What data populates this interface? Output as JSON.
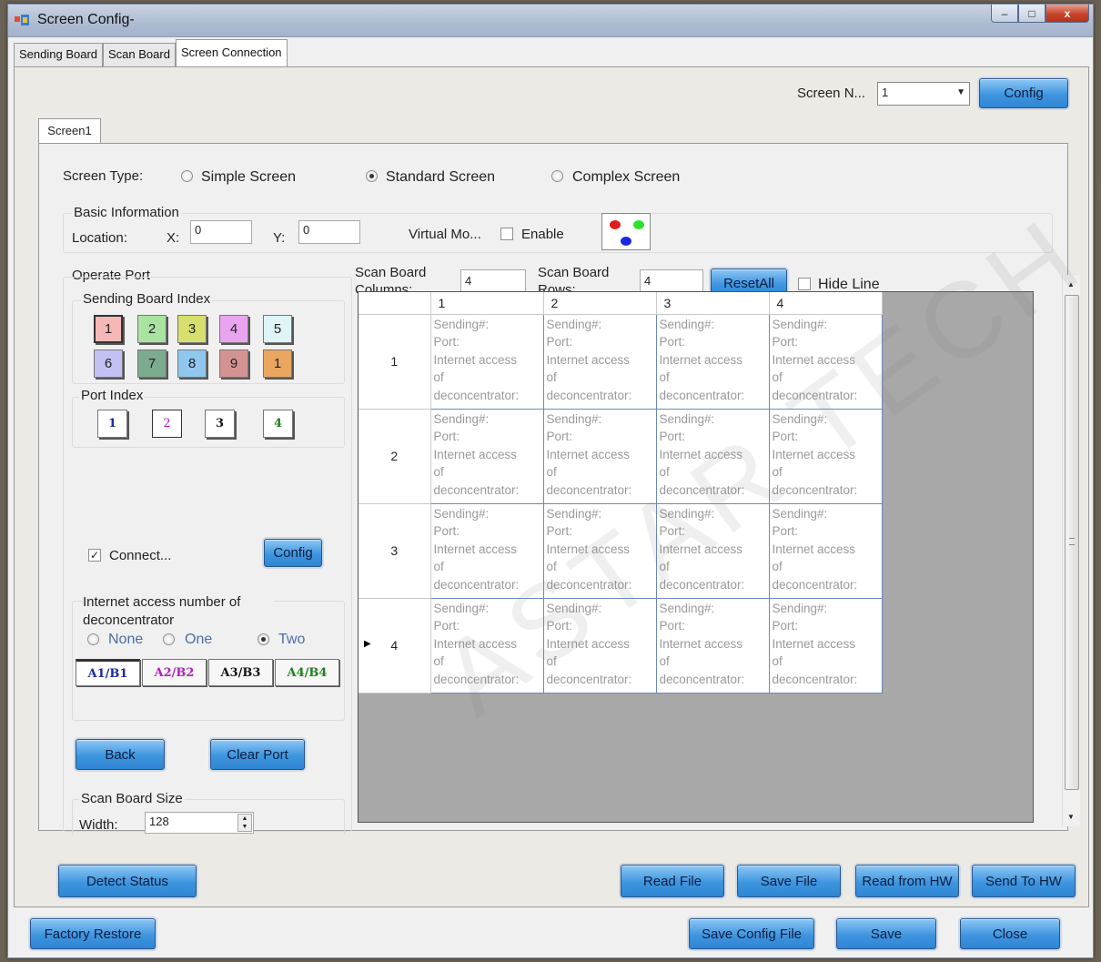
{
  "window": {
    "title": "Screen Config-",
    "controls": [
      "–",
      "□",
      "x"
    ]
  },
  "tabs": [
    "Sending Board",
    "Scan Board",
    "Screen Connection"
  ],
  "active_tab": "Screen Connection",
  "screen_selector": {
    "label": "Screen N...",
    "value": "1",
    "config_label": "Config"
  },
  "screen_tab": "Screen1",
  "screen_type": {
    "label": "Screen Type:",
    "options": [
      "Simple Screen",
      "Standard Screen",
      "Complex Screen"
    ],
    "selected": "Standard Screen"
  },
  "basic_info": {
    "title": "Basic Information",
    "location_label": "Location:",
    "x_label": "X:",
    "x_value": "0",
    "y_label": "Y:",
    "y_value": "0",
    "virtual_label": "Virtual Mo...",
    "enable_label": "Enable",
    "enable_checked": false
  },
  "operate_port": {
    "title": "Operate Port",
    "sending_board_index": {
      "title": "Sending Board Index",
      "buttons": [
        {
          "label": "1",
          "color": "#f6b7b7"
        },
        {
          "label": "2",
          "color": "#a9e3a2"
        },
        {
          "label": "3",
          "color": "#d8e06d"
        },
        {
          "label": "4",
          "color": "#e9a4ef"
        },
        {
          "label": "5",
          "color": "#dff4f6"
        },
        {
          "label": "6",
          "color": "#c3c0f4"
        },
        {
          "label": "7",
          "color": "#7dab8f"
        },
        {
          "label": "8",
          "color": "#8fc7ee"
        },
        {
          "label": "9",
          "color": "#d39393"
        },
        {
          "label": "1",
          "color": "#e9a760"
        }
      ]
    },
    "port_index": {
      "title": "Port Index",
      "buttons": [
        {
          "label": "1",
          "color": "#1a2aa0"
        },
        {
          "label": "2",
          "color": "#b020c0"
        },
        {
          "label": "3",
          "color": "#111111"
        },
        {
          "label": "4",
          "color": "#1e7f1e"
        }
      ]
    },
    "connect_label": "Connect...",
    "connect_checked": true,
    "config_label": "Config",
    "internet_access": {
      "title": "Internet access number of deconcentrator",
      "options": [
        "None",
        "One",
        "Two"
      ],
      "selected": "Two",
      "ab_buttons": [
        {
          "label": "A1/B1",
          "color": "#1a2aa0"
        },
        {
          "label": "A2/B2",
          "color": "#b020c0"
        },
        {
          "label": "A3/B3",
          "color": "#111111"
        },
        {
          "label": "A4/B4",
          "color": "#1e7f1e"
        }
      ]
    },
    "back_label": "Back",
    "clear_port_label": "Clear Port",
    "scan_board_size": {
      "title": "Scan Board Size",
      "width_label": "Width:",
      "width_value": "128"
    }
  },
  "scan_board": {
    "columns_label": "Scan Board Columns:",
    "columns_value": "4",
    "rows_label": "Scan Board Rows:",
    "rows_value": "4",
    "reset_all_label": "ResetAll",
    "hide_line_label": "Hide Line",
    "hide_line_checked": false
  },
  "grid": {
    "columns": [
      "1",
      "2",
      "3",
      "4"
    ],
    "rows": [
      "1",
      "2",
      "3",
      "4"
    ],
    "current_row": "4",
    "cell_lines": [
      "Sending#:",
      "Port:",
      "Internet access",
      "of",
      "deconcentrator:"
    ]
  },
  "bottom_buttons": {
    "detect_status": "Detect Status",
    "read_file": "Read File",
    "save_file": "Save File",
    "read_from_hw": "Read from HW",
    "send_to_hw": "Send To HW",
    "factory_restore": "Factory Restore",
    "save_config_file": "Save Config File",
    "save": "Save",
    "close": "Close"
  },
  "watermark": "ASTAR TECH CO., L",
  "colors": {
    "button_blue": "#3e95df",
    "grid_border": "#6f87b8"
  }
}
